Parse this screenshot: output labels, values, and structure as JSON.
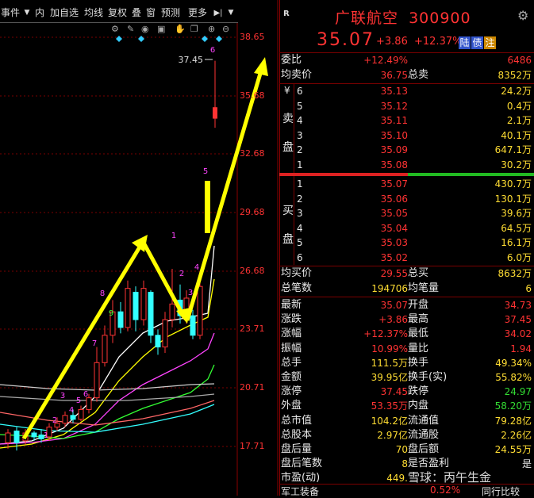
{
  "toolbar": {
    "items": [
      "事件",
      "▼",
      "内",
      "加自选",
      "均线",
      "复权",
      "叠",
      "窗",
      "预测",
      "更多",
      "▶|",
      "▼"
    ]
  },
  "chart": {
    "price_labels": [
      "38.65",
      "35.68",
      "32.68",
      "29.68",
      "26.68",
      "23.71",
      "20.71",
      "17.71"
    ],
    "high_label": "37.45",
    "markers": [
      "1",
      "2",
      "3",
      "4",
      "5",
      "6",
      "7",
      "8",
      "9",
      "1",
      "2",
      "3",
      "4",
      "5",
      "6"
    ]
  },
  "colors": {
    "up": "#ff3333",
    "down": "#33ffff",
    "grid": "#7a0000",
    "arrow": "#ffff00"
  },
  "quote": {
    "market_tag": "R",
    "name": "广联航空",
    "code": "300900",
    "price": "35.07",
    "change": "+3.86",
    "change_pct": "+12.37%",
    "badges": [
      "陆",
      "债",
      "注"
    ],
    "weibi_label": "委比",
    "weibi": "+12.49%",
    "weicha": "6486",
    "avg_sell_label": "均卖价",
    "avg_sell": "36.75",
    "total_sell_label": "总卖",
    "total_sell": "8352万",
    "sell_side_label": [
      "卖",
      "盘"
    ],
    "currency": "¥",
    "asks": [
      {
        "level": "6",
        "price": "35.13",
        "vol": "24.2万"
      },
      {
        "level": "5",
        "price": "35.12",
        "vol": "0.4万"
      },
      {
        "level": "4",
        "price": "35.11",
        "vol": "2.1万"
      },
      {
        "level": "3",
        "price": "35.10",
        "vol": "40.1万"
      },
      {
        "level": "2",
        "price": "35.09",
        "vol": "647.1万"
      },
      {
        "level": "1",
        "price": "35.08",
        "vol": "30.2万"
      }
    ],
    "buy_side_label": [
      "买",
      "盘"
    ],
    "bids": [
      {
        "level": "1",
        "price": "35.07",
        "vol": "430.7万"
      },
      {
        "level": "2",
        "price": "35.06",
        "vol": "130.1万"
      },
      {
        "level": "3",
        "price": "35.05",
        "vol": "39.6万"
      },
      {
        "level": "4",
        "price": "35.04",
        "vol": "64.5万"
      },
      {
        "level": "5",
        "price": "35.03",
        "vol": "16.1万"
      },
      {
        "level": "6",
        "price": "35.02",
        "vol": "6.0万"
      }
    ],
    "avg_buy_label": "均买价",
    "avg_buy": "29.55",
    "total_buy_label": "总买",
    "total_buy": "8632万",
    "deal_count_label": "总笔数",
    "deal_count": "194706",
    "avg_lot_label": "均笔量",
    "avg_lot": "6",
    "stats": [
      {
        "l1": "最新",
        "v1": "35.07",
        "c1": "red",
        "l2": "开盘",
        "v2": "34.73",
        "c2": "red"
      },
      {
        "l1": "涨跌",
        "v1": "+3.86",
        "c1": "red",
        "l2": "最高",
        "v2": "37.45",
        "c2": "red"
      },
      {
        "l1": "涨幅",
        "v1": "+12.37%",
        "c1": "red",
        "l2": "最低",
        "v2": "34.02",
        "c2": "red"
      },
      {
        "l1": "振幅",
        "v1": "10.99%",
        "c1": "red",
        "l2": "量比",
        "v2": "1.94",
        "c2": "red"
      },
      {
        "l1": "总手",
        "v1": "111.5万",
        "c1": "yel",
        "l2": "换手",
        "v2": "49.34%",
        "c2": "yel"
      },
      {
        "l1": "金额",
        "v1": "39.95亿",
        "c1": "yel",
        "l2": "换手(实)",
        "v2": "55.82%",
        "c2": "yel"
      },
      {
        "l1": "涨停",
        "v1": "37.45",
        "c1": "red",
        "l2": "跌停",
        "v2": "24.97",
        "c2": "grn"
      },
      {
        "l1": "外盘",
        "v1": "53.35万",
        "c1": "red",
        "l2": "内盘",
        "v2": "58.20万",
        "c2": "grn"
      },
      {
        "l1": "总市值",
        "v1": "104.2亿",
        "c1": "yel",
        "l2": "流通值",
        "v2": "79.28亿",
        "c2": "yel"
      },
      {
        "l1": "总股本",
        "v1": "2.97亿",
        "c1": "yel",
        "l2": "流通股",
        "v2": "2.26亿",
        "c2": "yel"
      },
      {
        "l1": "盘后量",
        "v1": "70",
        "c1": "yel",
        "l2": "盘后额",
        "v2": "24.55万",
        "c2": "yel"
      },
      {
        "l1": "盘后笔数",
        "v1": "8",
        "c1": "yel",
        "l2": "是否盈利",
        "v2": "是",
        "c2": "wht"
      },
      {
        "l1": "市盈(动)",
        "v1": "449.",
        "c1": "yel",
        "l2": "",
        "v2": "",
        "c2": "wht"
      }
    ],
    "footer_left": "军工装备",
    "footer_mid": "0.52%",
    "footer_right": "同行比较",
    "watermark": "雪球：丙午生金"
  }
}
